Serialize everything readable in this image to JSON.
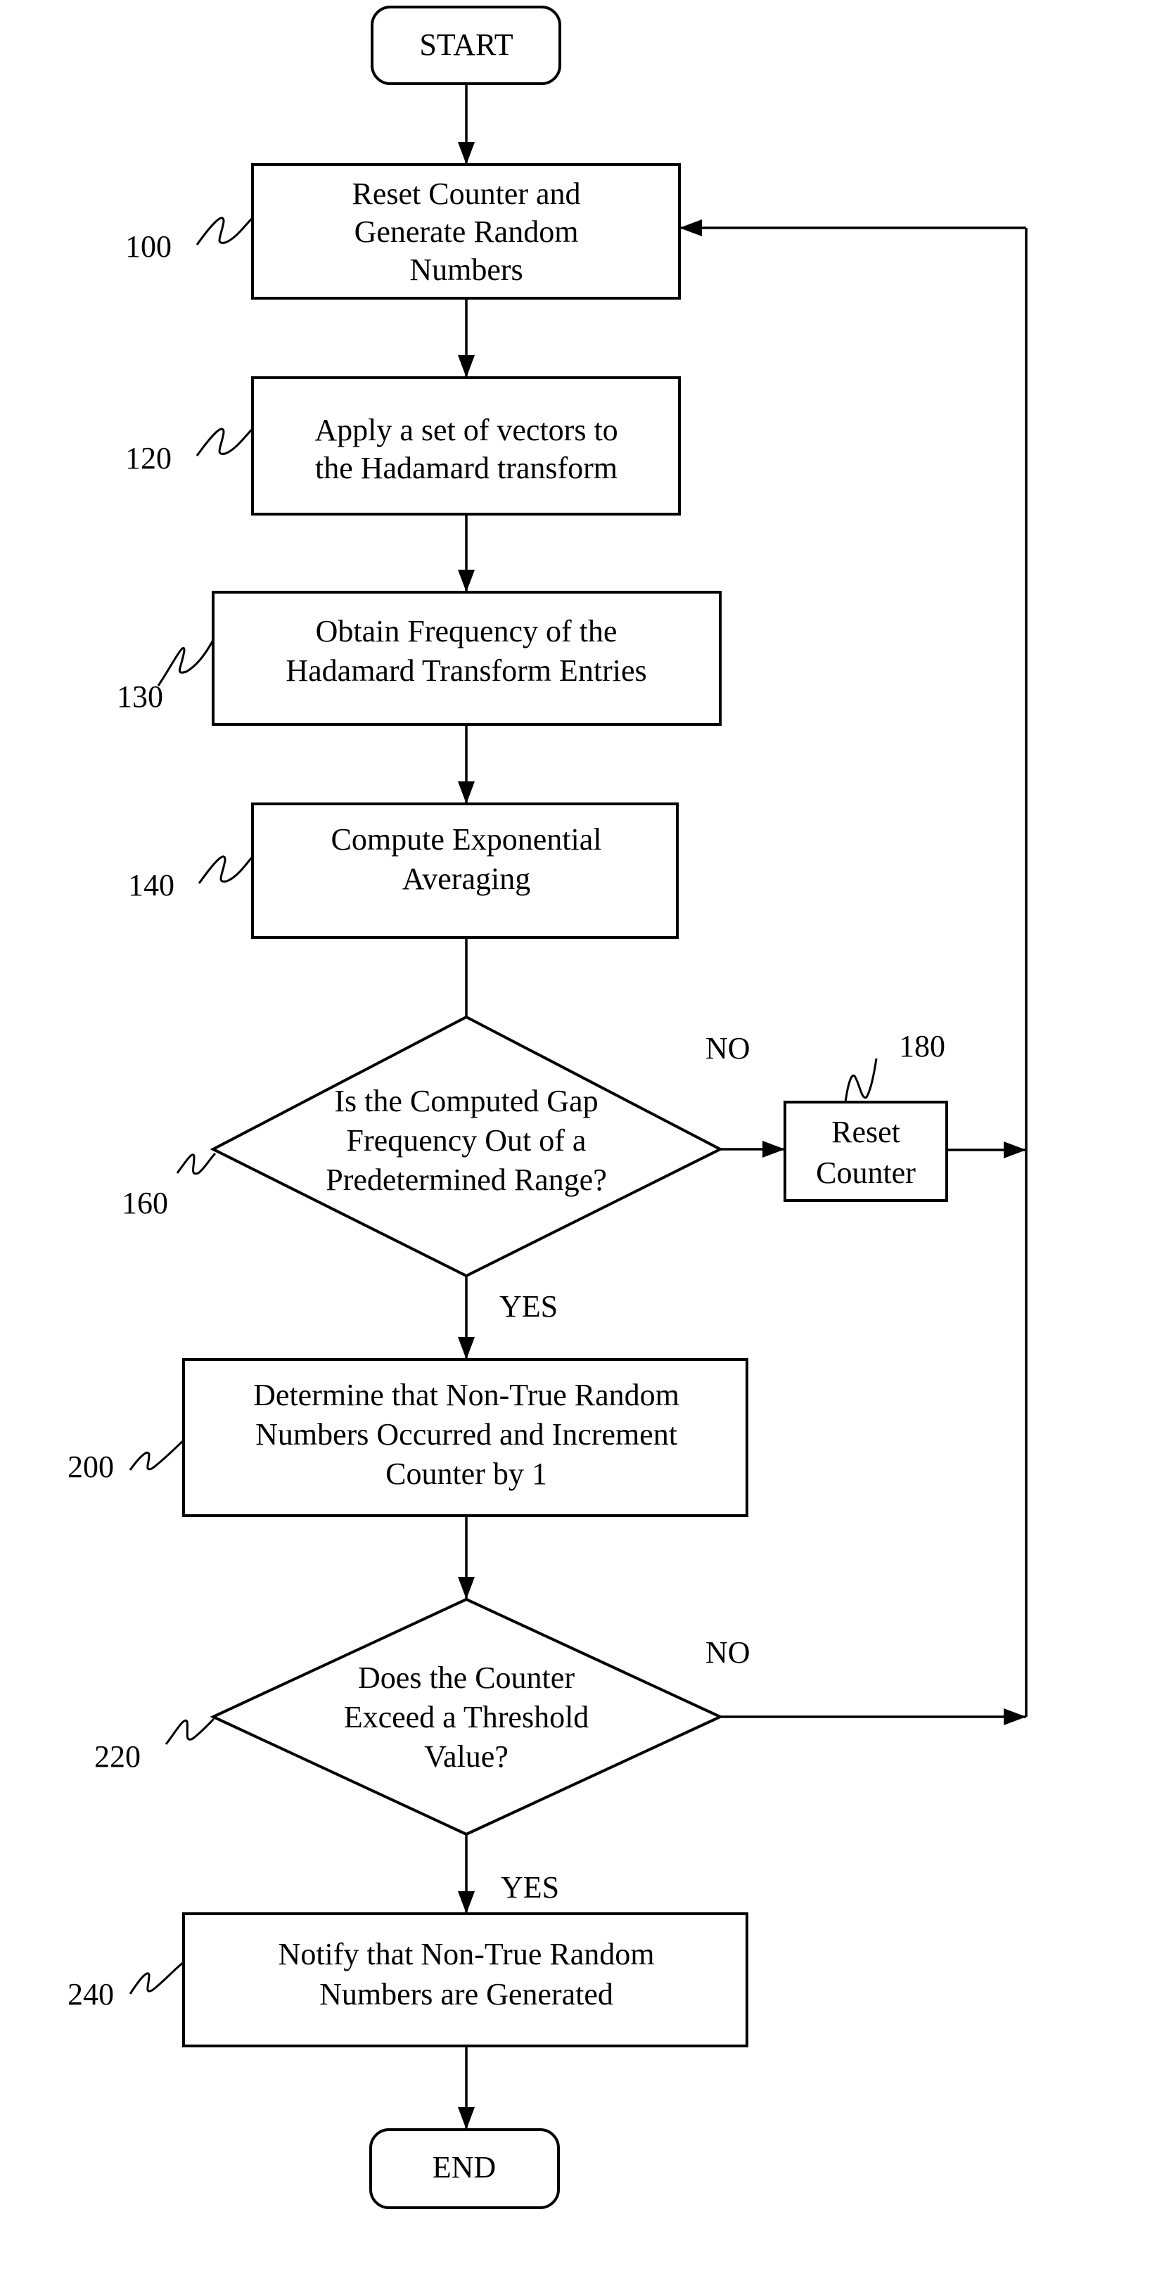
{
  "diagram": {
    "type": "flowchart",
    "start": {
      "label": "START"
    },
    "end": {
      "label": "END"
    },
    "steps": [
      {
        "ref": "100",
        "lines": [
          "Reset Counter and",
          "Generate Random",
          "Numbers"
        ]
      },
      {
        "ref": "120",
        "lines": [
          "Apply a set of vectors to",
          "the Hadamard transform"
        ]
      },
      {
        "ref": "130",
        "lines": [
          "Obtain Frequency of the",
          "Hadamard Transform Entries"
        ]
      },
      {
        "ref": "140",
        "lines": [
          "Compute Exponential",
          "Averaging"
        ]
      },
      {
        "ref": "200",
        "lines": [
          "Determine that Non-True Random",
          "Numbers Occurred and Increment",
          "Counter by 1"
        ]
      },
      {
        "ref": "240",
        "lines": [
          "Notify that Non-True Random",
          "Numbers are Generated"
        ]
      }
    ],
    "decisions": [
      {
        "ref": "160",
        "lines": [
          "Is the Computed Gap",
          "Frequency Out of a",
          "Predetermined Range?"
        ],
        "yes_label": "YES",
        "no_label": "NO"
      },
      {
        "ref": "220",
        "lines": [
          "Does the Counter",
          "Exceed a Threshold",
          "Value?"
        ],
        "yes_label": "YES",
        "no_label": "NO"
      }
    ],
    "side_step": {
      "ref": "180",
      "lines": [
        "Reset",
        "Counter"
      ]
    },
    "edges": [
      {
        "from": "START",
        "to": "100"
      },
      {
        "from": "100",
        "to": "120"
      },
      {
        "from": "120",
        "to": "130"
      },
      {
        "from": "130",
        "to": "140"
      },
      {
        "from": "140",
        "to": "160"
      },
      {
        "from": "160",
        "to": "200",
        "label": "YES"
      },
      {
        "from": "160",
        "to": "180",
        "label": "NO"
      },
      {
        "from": "180",
        "to": "100"
      },
      {
        "from": "200",
        "to": "220"
      },
      {
        "from": "220",
        "to": "240",
        "label": "YES"
      },
      {
        "from": "220",
        "to": "100",
        "label": "NO"
      },
      {
        "from": "240",
        "to": "END"
      }
    ]
  }
}
